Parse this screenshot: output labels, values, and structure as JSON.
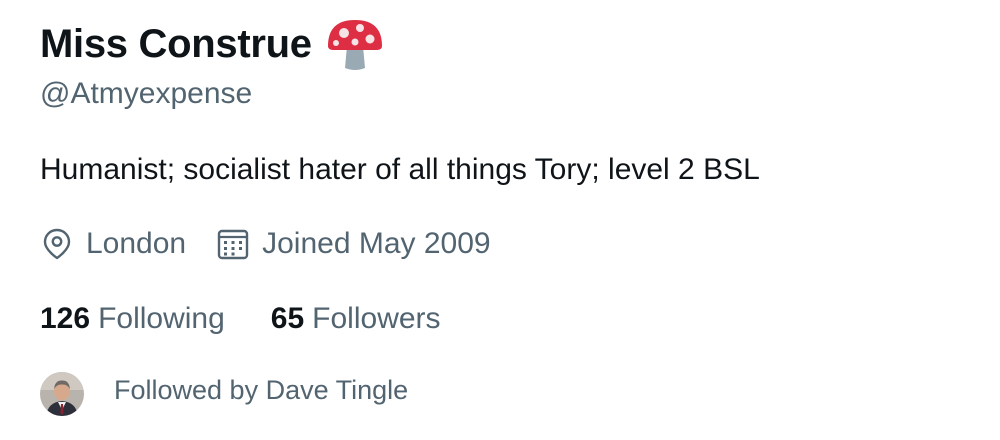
{
  "profile": {
    "display_name": "Miss Construe",
    "name_emoji_icon": "mushroom-icon",
    "handle": "@Atmyexpense",
    "bio": "Humanist; socialist hater of all things Tory; level 2 BSL",
    "location": {
      "icon": "location-pin-icon",
      "text": "London"
    },
    "joined": {
      "icon": "calendar-icon",
      "text": "Joined May 2009"
    },
    "stats": {
      "following_count": "126",
      "following_label": "Following",
      "followers_count": "65",
      "followers_label": "Followers"
    },
    "followed_by": {
      "avatar_icon": "avatar",
      "text": "Followed by Dave Tingle"
    }
  },
  "colors": {
    "primary_text": "#0f1419",
    "secondary_text": "#536471",
    "background": "#ffffff",
    "mushroom_cap": "#dd2e44",
    "mushroom_stem": "#99aab5"
  }
}
